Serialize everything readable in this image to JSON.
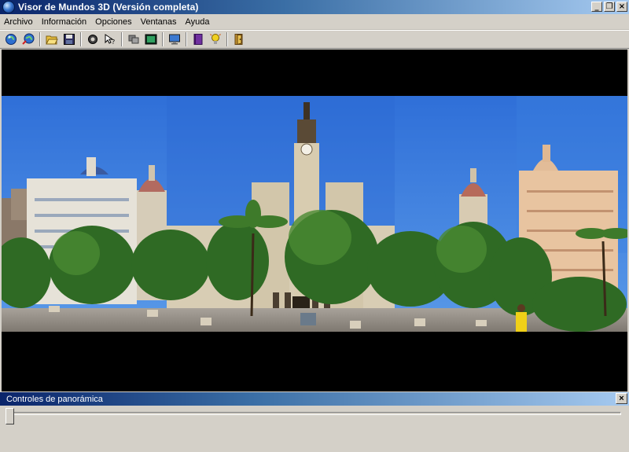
{
  "window": {
    "title": "Visor de Mundos 3D (Versión completa)"
  },
  "window_controls": {
    "minimize": "_",
    "maximize": "❐",
    "close": "×"
  },
  "menu": [
    "Archivo",
    "Información",
    "Opciones",
    "Ventanas",
    "Ayuda"
  ],
  "toolbar": {
    "groups": [
      [
        "globe-open-icon",
        "globe-link-icon"
      ],
      [
        "open-folder-icon",
        "save-icon"
      ],
      [
        "gear-icon",
        "help-cursor-icon"
      ],
      [
        "layers-icon",
        "image-view-icon"
      ],
      [
        "monitor-icon"
      ],
      [
        "book-icon",
        "lightbulb-icon"
      ],
      [
        "exit-door-icon"
      ]
    ]
  },
  "panel": {
    "title": "Controles de panorámica",
    "close": "×"
  },
  "slider": {
    "value": 0
  }
}
